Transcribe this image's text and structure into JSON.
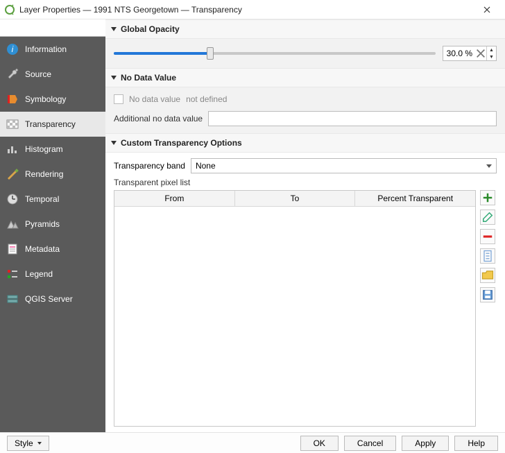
{
  "window": {
    "title": "Layer Properties — 1991 NTS Georgetown — Transparency"
  },
  "sidebar": {
    "search_value": "",
    "items": [
      {
        "label": "Information",
        "icon": "info-icon"
      },
      {
        "label": "Source",
        "icon": "wrench-icon"
      },
      {
        "label": "Symbology",
        "icon": "paint-icon"
      },
      {
        "label": "Transparency",
        "icon": "transparency-icon"
      },
      {
        "label": "Histogram",
        "icon": "histogram-icon"
      },
      {
        "label": "Rendering",
        "icon": "brush-icon"
      },
      {
        "label": "Temporal",
        "icon": "clock-icon"
      },
      {
        "label": "Pyramids",
        "icon": "pyramids-icon"
      },
      {
        "label": "Metadata",
        "icon": "metadata-icon"
      },
      {
        "label": "Legend",
        "icon": "legend-icon"
      },
      {
        "label": "QGIS Server",
        "icon": "server-icon"
      }
    ]
  },
  "sections": {
    "global_opacity": {
      "title": "Global Opacity",
      "value": "30.0 %",
      "percent": 30
    },
    "no_data": {
      "title": "No Data Value",
      "checkbox_label": "No data value",
      "status": "not defined",
      "additional_label": "Additional no data value",
      "additional_value": ""
    },
    "custom": {
      "title": "Custom Transparency Options",
      "band_label": "Transparency band",
      "band_value": "None",
      "pixlist_label": "Transparent pixel list",
      "columns": {
        "from": "From",
        "to": "To",
        "pct": "Percent Transparent"
      }
    }
  },
  "footer": {
    "style": "Style",
    "ok": "OK",
    "cancel": "Cancel",
    "apply": "Apply",
    "help": "Help"
  }
}
